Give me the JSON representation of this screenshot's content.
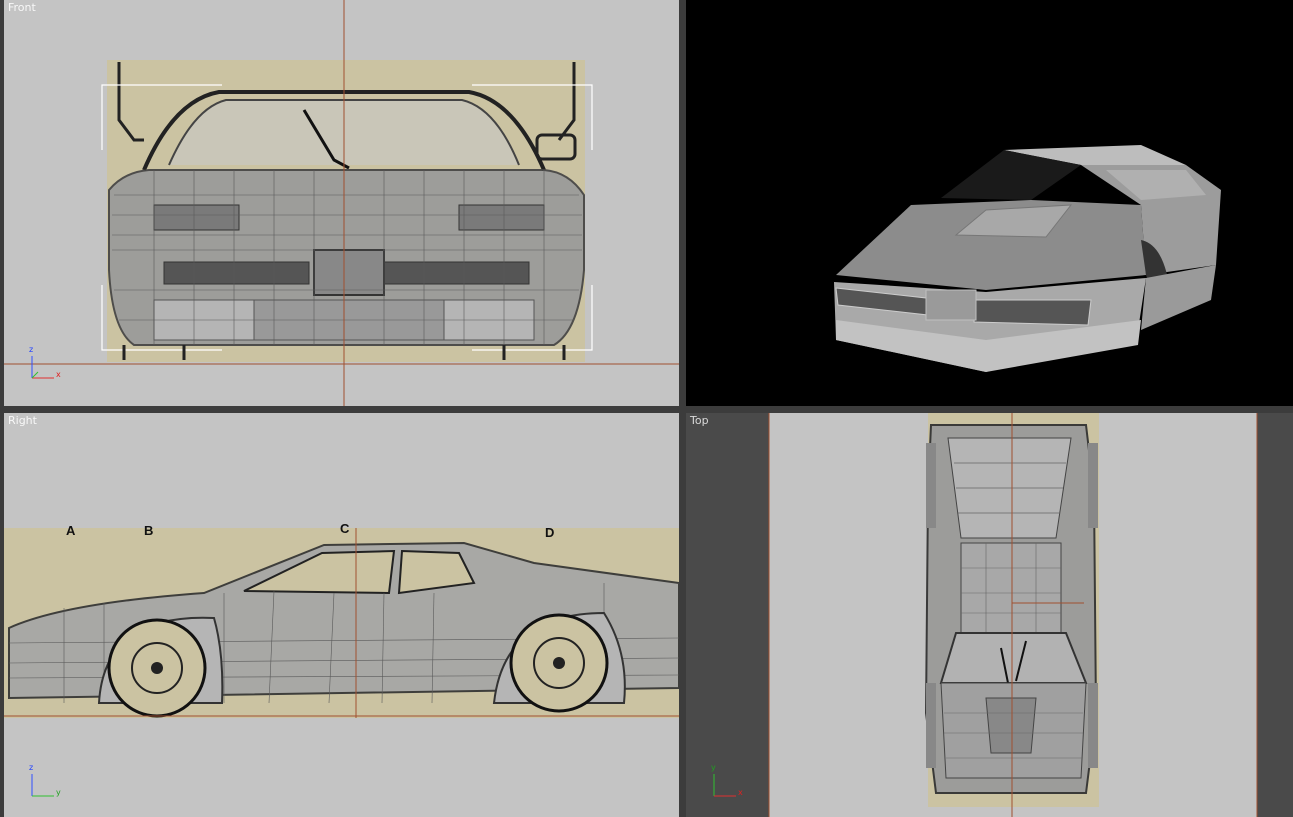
{
  "viewports": [
    {
      "id": "front",
      "label": "Front"
    },
    {
      "id": "perspective",
      "label": ""
    },
    {
      "id": "right",
      "label": "Right"
    },
    {
      "id": "top",
      "label": "Top"
    }
  ],
  "axes": {
    "front": {
      "up": "z",
      "side": "x"
    },
    "right": {
      "up": "z",
      "side": "y"
    },
    "top": {
      "up": "y",
      "side": "x"
    }
  },
  "blueprint_labels": [
    "A",
    "B",
    "C",
    "D"
  ],
  "colors": {
    "viewport_bg": "#c4c4c4",
    "perspective_bg": "#000000",
    "blueprint": "#cfc6a6",
    "grid_line": "#a05030",
    "axis_x": "#e03030",
    "axis_y": "#30c030",
    "axis_z": "#3050ff"
  }
}
